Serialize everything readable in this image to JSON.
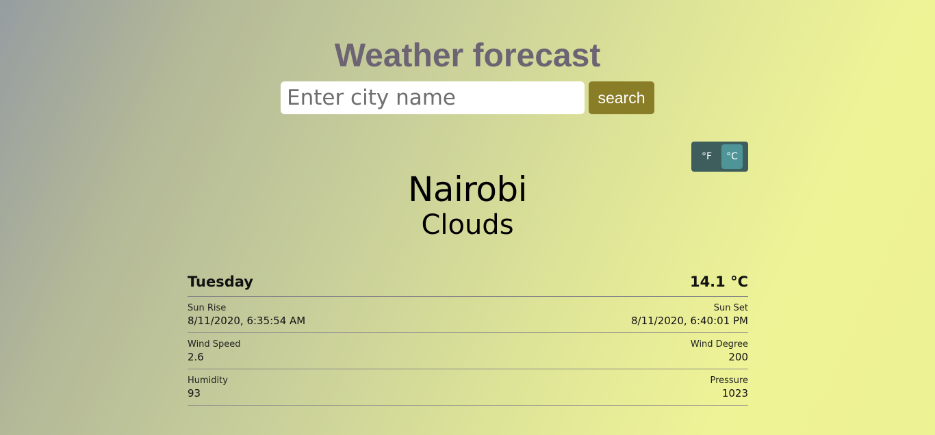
{
  "header": {
    "title": "Weather forecast"
  },
  "search": {
    "placeholder": "Enter city name",
    "value": "",
    "button_label": "search"
  },
  "units": {
    "fahrenheit_label": "°F",
    "celsius_label": "°C",
    "selected": "°C"
  },
  "location": {
    "city": "Nairobi",
    "condition": "Clouds"
  },
  "forecast": {
    "day": "Tuesday",
    "temperature": "14.1 °C",
    "sun_rise_label": "Sun Rise",
    "sun_rise_value": "8/11/2020, 6:35:54 AM",
    "sun_set_label": "Sun Set",
    "sun_set_value": "8/11/2020, 6:40:01 PM",
    "wind_speed_label": "Wind Speed",
    "wind_speed_value": "2.6",
    "wind_degree_label": "Wind Degree",
    "wind_degree_value": "200",
    "humidity_label": "Humidity",
    "humidity_value": "93",
    "pressure_label": "Pressure",
    "pressure_value": "1023"
  },
  "colors": {
    "title": "#6c6373",
    "search_button": "#8a7d28",
    "toggle_bg": "#3e5d5d",
    "toggle_active": "#4f9598"
  }
}
